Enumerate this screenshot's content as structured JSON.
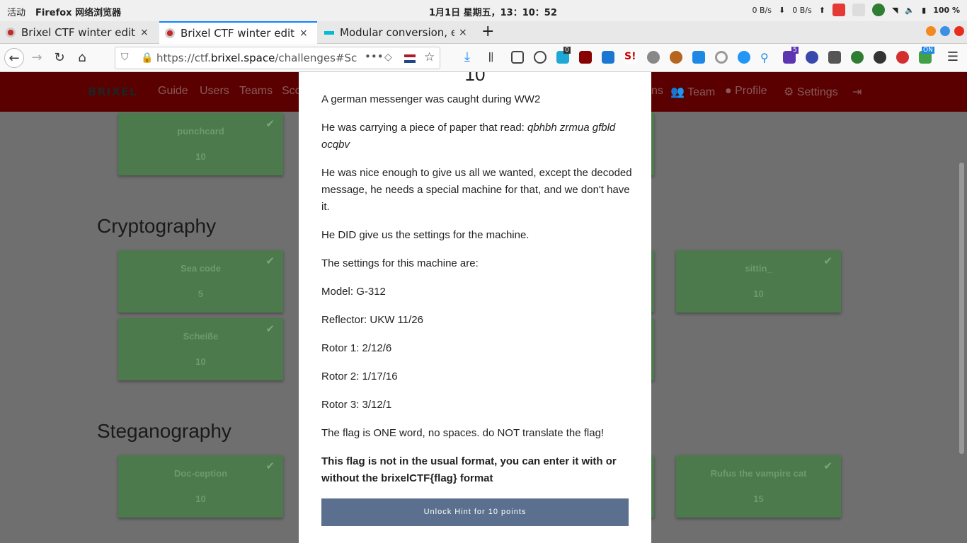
{
  "topbar": {
    "activities": "活动",
    "app_name": "Firefox 网络浏览器",
    "clock": "1月1日 星期五，13：10：52",
    "net_down": "0 B/s",
    "net_up": "0 B/s",
    "battery": "100 %"
  },
  "tabs": [
    {
      "title": "Brixel CTF winter edition",
      "close": "×"
    },
    {
      "title": "Brixel CTF winter edition",
      "close": "×"
    },
    {
      "title": "Modular conversion, enc",
      "close": "×"
    }
  ],
  "new_tab": "+",
  "navbar": {
    "url_prefix": "https://ctf.",
    "url_host": "brixel.space",
    "url_rest": "/challenges#Sche",
    "more": "•••",
    "ext_badges": {
      "badge1": "0",
      "badge2": "5",
      "badge3": "ON"
    }
  },
  "site_nav": {
    "logo": "BRIXEL",
    "links": [
      "Guide",
      "Users",
      "Teams",
      "Sco"
    ],
    "right_links": [
      "ns",
      "Team",
      "Profile",
      "Settings"
    ]
  },
  "sections": [
    {
      "title": "Cryptography"
    },
    {
      "title": "Steganography"
    }
  ],
  "cards": [
    {
      "name": "punchcard",
      "points": "10"
    },
    {
      "name": "Sea code",
      "points": "5"
    },
    {
      "name": "Scheiße",
      "points": "10"
    },
    {
      "name": "sittin_",
      "points": "10"
    },
    {
      "name": "Doc-ception",
      "points": "10"
    },
    {
      "name": "Rufus the vampire cat",
      "points": "15"
    }
  ],
  "modal": {
    "points": "10",
    "p1": "A german messenger was caught during WW2",
    "p2_lead": "He was carrying a piece of paper that read: ",
    "p2_em": "qbhbh zrmua gfbld ocqbv",
    "p3": "He was nice enough to give us all we wanted, except the decoded message, he needs a special machine for that, and we don't have it.",
    "p4": "He DID give us the settings for the machine.",
    "p5": "The settings for this machine are:",
    "p6": "Model: G-312",
    "p7": "Reflector: UKW 11/26",
    "p8": "Rotor 1: 2/12/6",
    "p9": "Rotor 2: 1/17/16",
    "p10": "Rotor 3: 3/12/1",
    "p11": "The flag is ONE word, no spaces. do NOT translate the flag!",
    "p12": "This flag is not in the usual format, you can enter it with or without the brixelCTF{flag} format",
    "unlock_button": "Unlock Hint for 10 points"
  },
  "colors": {
    "accent_tab": "#0a84ff",
    "nav_red": "#5a0000",
    "card_green": "#4c7a4c",
    "button": "#5a708e"
  }
}
